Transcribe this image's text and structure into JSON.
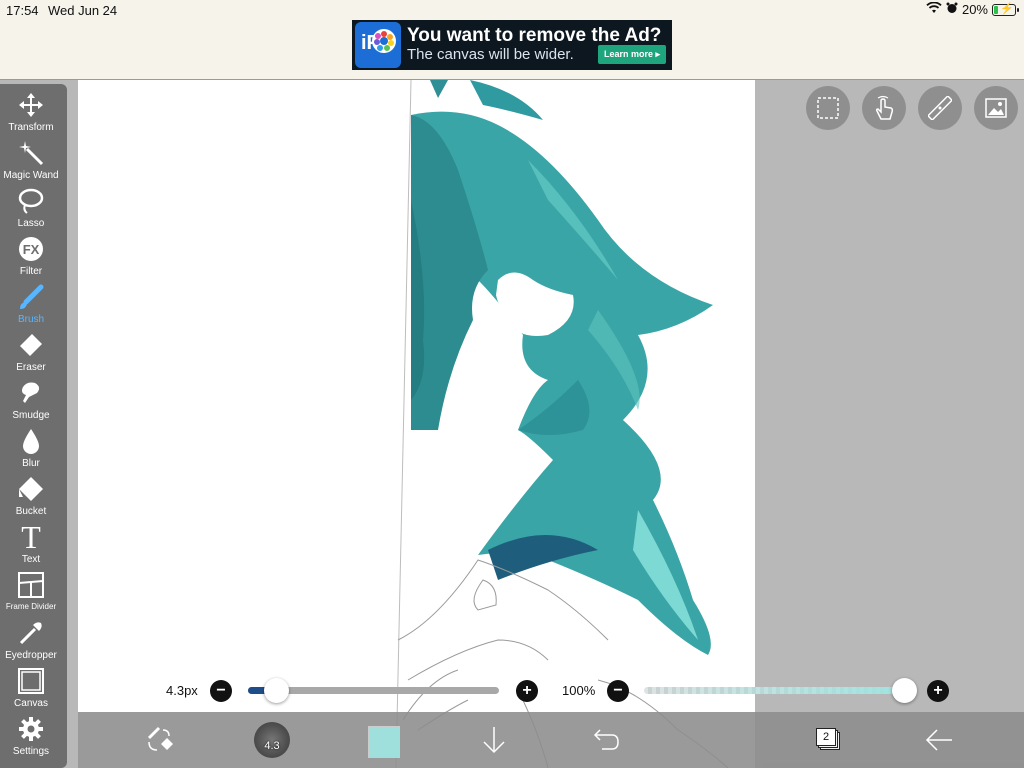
{
  "status": {
    "time": "17:54",
    "date": "Wed Jun 24",
    "battery": "20%",
    "battery_level": 0.2,
    "battery_color": "#2bc24b"
  },
  "ad": {
    "headline": "You want to remove the Ad?",
    "sub": "The canvas will be wider.",
    "cta": "Learn more ▸",
    "logo": "iP"
  },
  "tools": [
    {
      "label": "Transform",
      "icon": "move-arrows-icon"
    },
    {
      "label": "Magic Wand",
      "icon": "magic-wand-icon"
    },
    {
      "label": "Lasso",
      "icon": "lasso-icon"
    },
    {
      "label": "Filter",
      "icon": "fx-icon",
      "glyph": "FX"
    },
    {
      "label": "Brush",
      "icon": "brush-icon",
      "active": true
    },
    {
      "label": "Eraser",
      "icon": "eraser-icon"
    },
    {
      "label": "Smudge",
      "icon": "smudge-icon"
    },
    {
      "label": "Blur",
      "icon": "drop-icon"
    },
    {
      "label": "Bucket",
      "icon": "bucket-icon"
    },
    {
      "label": "Text",
      "icon": "text-icon",
      "glyph": "T"
    },
    {
      "label": "Frame Divider",
      "icon": "frame-divider-icon"
    },
    {
      "label": "Eyedropper",
      "icon": "eyedropper-icon"
    },
    {
      "label": "Canvas",
      "icon": "canvas-icon"
    },
    {
      "label": "Settings",
      "icon": "gear-icon"
    }
  ],
  "top_right_buttons": [
    "selection-icon",
    "hand-touch-icon",
    "ruler-icon",
    "image-icon"
  ],
  "sliders": {
    "brush_size": "4.3px",
    "brush_size_fraction": 0.11,
    "opacity": "100%",
    "opacity_fraction": 1.0
  },
  "bottom": {
    "brush_size_short": "4.3",
    "current_color": "#9fe0dc",
    "layers_count": "2",
    "icons": [
      "brush-eraser-swap-icon",
      "brush-preview-icon",
      "color-swatch",
      "download-arrow-icon",
      "undo-icon",
      "layers-icon",
      "back-arrow-icon"
    ]
  },
  "colors": {
    "accent": "#58b5ff",
    "toolbar": "#6e6e6e",
    "hair_dark": "#1f7c83",
    "hair_light": "#58c9c4"
  }
}
